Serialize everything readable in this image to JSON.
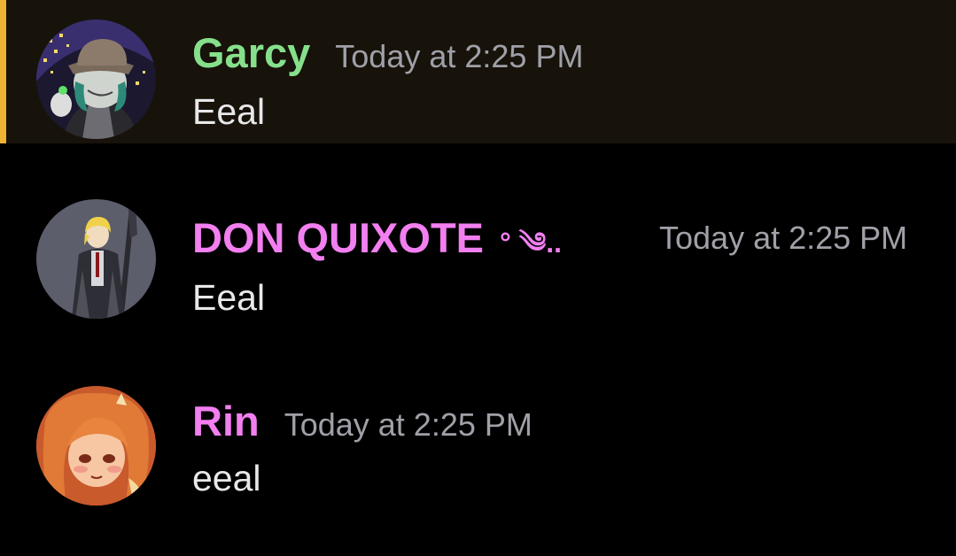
{
  "colors": {
    "background": "#000000",
    "highlight_background": "#17130b",
    "highlight_bar": "#f0b232",
    "timestamp": "#a0a0a8",
    "message_text": "#e8e8ea"
  },
  "messages": [
    {
      "username": "Garcy",
      "username_color": "#86e08b",
      "timestamp": "Today at 2:25 PM",
      "content": "Eeal",
      "avatar_icon": "avatar-hat-character-icon",
      "highlighted": true
    },
    {
      "username": "DON QUIXOTE",
      "username_decor": "° ༄..",
      "username_color": "#f27ff0",
      "timestamp": "Today at 2:25 PM",
      "content": "Eeal",
      "avatar_icon": "avatar-knight-character-icon",
      "highlighted": false
    },
    {
      "username": "Rin",
      "username_color": "#f27ff0",
      "timestamp": "Today at 2:25 PM",
      "content": "eeal",
      "avatar_icon": "avatar-redhead-character-icon",
      "highlighted": false
    }
  ]
}
